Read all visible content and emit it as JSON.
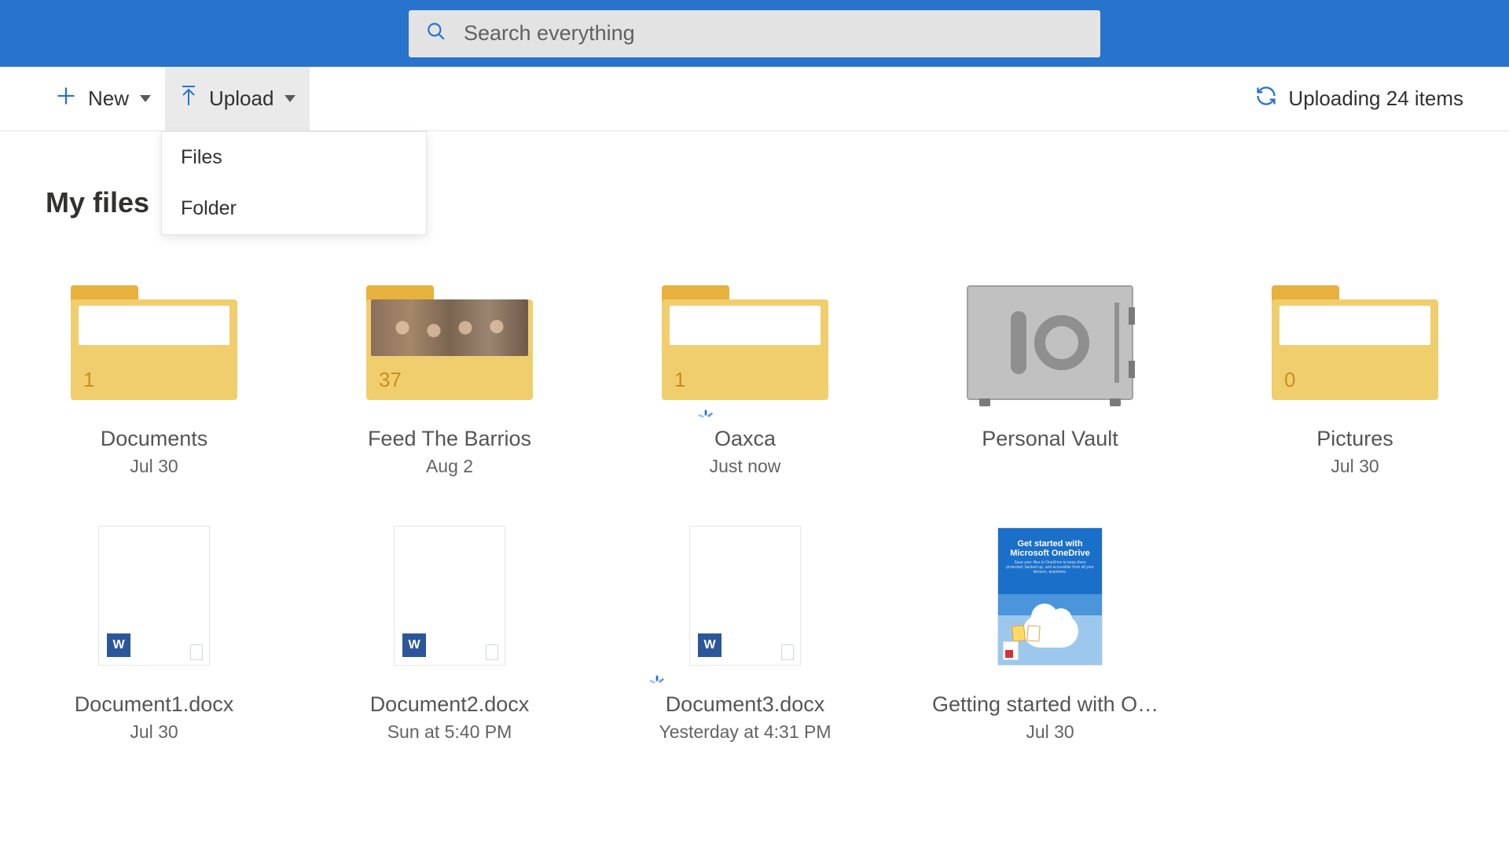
{
  "search": {
    "placeholder": "Search everything"
  },
  "toolbar": {
    "new_label": "New",
    "upload_label": "Upload",
    "status_label": "Uploading 24 items"
  },
  "upload_menu": {
    "files_label": "Files",
    "folder_label": "Folder"
  },
  "page": {
    "title": "My files"
  },
  "colors": {
    "brand": "#2873cc",
    "folder": "#f1ce6d",
    "folder_tab": "#e7b13e"
  },
  "items": [
    {
      "type": "folder",
      "name": "Documents",
      "date": "Jul 30",
      "count": "1",
      "syncing": false,
      "preview": false
    },
    {
      "type": "folder",
      "name": "Feed The Barrios",
      "date": "Aug 2",
      "count": "37",
      "syncing": false,
      "preview": true
    },
    {
      "type": "folder",
      "name": "Oaxca",
      "date": "Just now",
      "count": "1",
      "syncing": true,
      "preview": false
    },
    {
      "type": "vault",
      "name": "Personal Vault",
      "date": "",
      "syncing": false
    },
    {
      "type": "folder",
      "name": "Pictures",
      "date": "Jul 30",
      "count": "0",
      "syncing": false,
      "preview": false
    },
    {
      "type": "doc",
      "name": "Document1.docx",
      "date": "Jul 30",
      "syncing": false
    },
    {
      "type": "doc",
      "name": "Document2.docx",
      "date": "Sun at 5:40 PM",
      "syncing": false
    },
    {
      "type": "doc",
      "name": "Document3.docx",
      "date": "Yesterday at 4:31 PM",
      "syncing": true
    },
    {
      "type": "pdf",
      "name": "Getting started with On…",
      "date": "Jul 30",
      "syncing": false,
      "preview_title1": "Get started with",
      "preview_title2": "Microsoft OneDrive"
    }
  ]
}
